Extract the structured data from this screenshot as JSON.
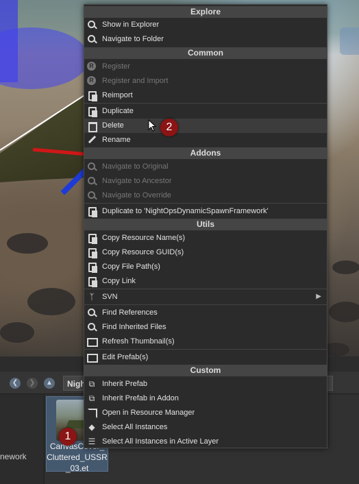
{
  "browser": {
    "path_text": "Night",
    "tree_label": "nework",
    "file_name": "CanvasCover_Cluttered_USSR_03.et",
    "file_name_lines": [
      "CanvasCover_",
      "Cluttered_USSR",
      "_03.et"
    ]
  },
  "context_menu": {
    "sections": [
      {
        "title": "Explore",
        "items": [
          {
            "label": "Show in Explorer",
            "icon": "search-icon",
            "enabled": true
          },
          {
            "label": "Navigate to Folder",
            "icon": "search-icon",
            "enabled": true
          }
        ]
      },
      {
        "title": "Common",
        "items": [
          {
            "label": "Register",
            "icon": "registry-icon",
            "enabled": false
          },
          {
            "label": "Register and Import",
            "icon": "registry-icon",
            "enabled": false
          },
          {
            "label": "Reimport",
            "icon": "reimport-icon",
            "enabled": true
          },
          {
            "label": "Duplicate",
            "icon": "duplicate-icon",
            "enabled": true
          },
          {
            "label": "Delete",
            "icon": "trash-icon",
            "enabled": true,
            "hovered": true
          },
          {
            "label": "Rename",
            "icon": "pencil-icon",
            "enabled": true
          }
        ]
      },
      {
        "title": "Addons",
        "items": [
          {
            "label": "Navigate to Original",
            "icon": "search-icon",
            "enabled": false
          },
          {
            "label": "Navigate to Ancestor",
            "icon": "search-icon",
            "enabled": false
          },
          {
            "label": "Navigate to Override",
            "icon": "search-icon",
            "enabled": false
          },
          {
            "label": "Duplicate to 'NightOpsDynamicSpawnFramework'",
            "icon": "duplicate-icon",
            "enabled": true
          }
        ]
      },
      {
        "title": "Utils",
        "items": [
          {
            "label": "Copy Resource Name(s)",
            "icon": "copy-icon",
            "enabled": true
          },
          {
            "label": "Copy Resource GUID(s)",
            "icon": "copy-icon",
            "enabled": true
          },
          {
            "label": "Copy File Path(s)",
            "icon": "copy-icon",
            "enabled": true
          },
          {
            "label": "Copy Link",
            "icon": "copy-icon",
            "enabled": true
          },
          {
            "label": "SVN",
            "icon": "branch-icon",
            "enabled": true,
            "submenu": true
          },
          {
            "label": "Find References",
            "icon": "search-icon",
            "enabled": true
          },
          {
            "label": "Find Inherited Files",
            "icon": "search-icon",
            "enabled": true
          },
          {
            "label": "Refresh Thumbnail(s)",
            "icon": "image-icon",
            "enabled": true
          },
          {
            "label": "Edit Prefab(s)",
            "icon": "edit-icon",
            "enabled": true
          }
        ]
      },
      {
        "title": "Custom",
        "items": [
          {
            "label": "Inherit Prefab",
            "icon": "inherit-icon",
            "enabled": true
          },
          {
            "label": "Inherit Prefab in Addon",
            "icon": "inherit-icon",
            "enabled": true
          },
          {
            "label": "Open in Resource Manager",
            "icon": "external-link-icon",
            "enabled": true
          },
          {
            "label": "Select All Instances",
            "icon": "select-all-icon",
            "enabled": true
          },
          {
            "label": "Select All Instances in Active Layer",
            "icon": "layers-icon",
            "enabled": true
          }
        ]
      }
    ]
  },
  "markers": {
    "one": "1",
    "two": "2"
  },
  "colors": {
    "marker": "#8b1414",
    "menu_bg": "#2b2b2b",
    "header_bg": "#454545",
    "hover_bg": "#3c3c3c"
  }
}
